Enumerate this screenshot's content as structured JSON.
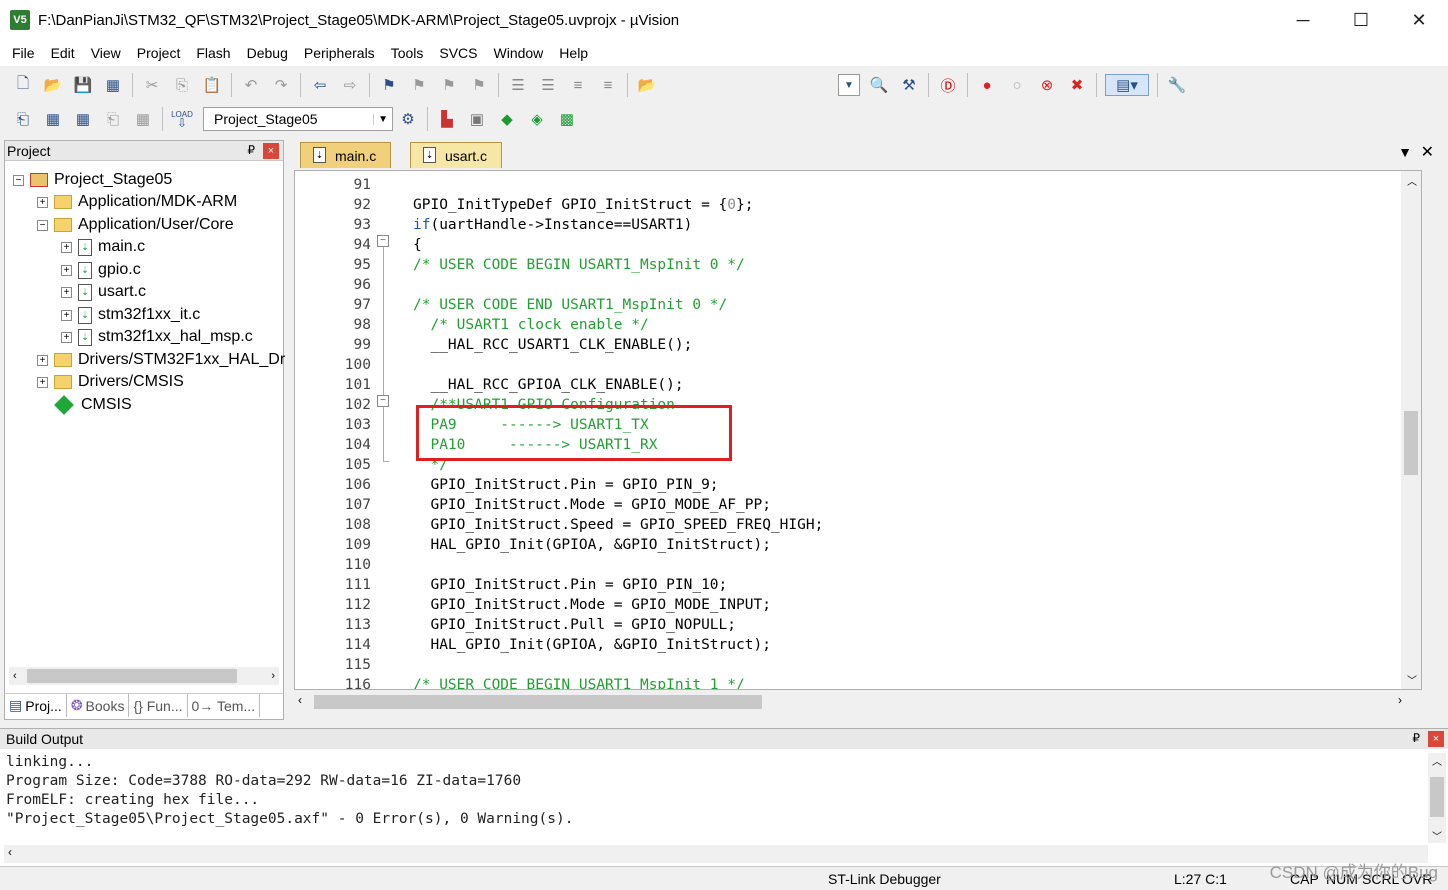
{
  "window": {
    "title": "F:\\DanPianJi\\STM32_QF\\STM32\\Project_Stage05\\MDK-ARM\\Project_Stage05.uvprojx - µVision",
    "app_icon_label": "V5",
    "minimize": "─",
    "maximize": "☐",
    "close": "✕"
  },
  "menu": [
    "File",
    "Edit",
    "View",
    "Project",
    "Flash",
    "Debug",
    "Peripherals",
    "Tools",
    "SVCS",
    "Window",
    "Help"
  ],
  "toolbar2": {
    "target_combo": "Project_Stage05",
    "load_label": "LOAD"
  },
  "project_panel": {
    "title": "Project",
    "pin": "₽",
    "close": "×",
    "tree": [
      {
        "label": "Project_Stage05",
        "level": 0,
        "type": "project",
        "expander": "−"
      },
      {
        "label": "Application/MDK-ARM",
        "level": 1,
        "type": "folder",
        "expander": "+"
      },
      {
        "label": "Application/User/Core",
        "level": 1,
        "type": "folder",
        "expander": "−"
      },
      {
        "label": "main.c",
        "level": 2,
        "type": "file",
        "expander": "+"
      },
      {
        "label": "gpio.c",
        "level": 2,
        "type": "file",
        "expander": "+"
      },
      {
        "label": "usart.c",
        "level": 2,
        "type": "file",
        "expander": "+"
      },
      {
        "label": "stm32f1xx_it.c",
        "level": 2,
        "type": "file",
        "expander": "+"
      },
      {
        "label": "stm32f1xx_hal_msp.c",
        "level": 2,
        "type": "file",
        "expander": "+"
      },
      {
        "label": "Drivers/STM32F1xx_HAL_Dr",
        "level": 1,
        "type": "folder",
        "expander": "+"
      },
      {
        "label": "Drivers/CMSIS",
        "level": 1,
        "type": "folder",
        "expander": "+"
      },
      {
        "label": "CMSIS",
        "level": 1,
        "type": "component",
        "expander": ""
      }
    ],
    "bottom_tabs": [
      "Proj...",
      "Books",
      "{} Fun...",
      "0→ Tem..."
    ]
  },
  "editor": {
    "tabs": [
      "main.c",
      "usart.c"
    ],
    "active_tab": "usart.c",
    "lines": [
      {
        "n": "91",
        "text": ""
      },
      {
        "n": "92",
        "text": "GPIO_InitTypeDef GPIO_InitStruct = {0};"
      },
      {
        "n": "93",
        "text": "if(uartHandle->Instance==USART1)"
      },
      {
        "n": "94",
        "text": "{"
      },
      {
        "n": "95",
        "text": "/* USER CODE BEGIN USART1_MspInit 0 */"
      },
      {
        "n": "96",
        "text": ""
      },
      {
        "n": "97",
        "text": "/* USER CODE END USART1_MspInit 0 */"
      },
      {
        "n": "98",
        "text": "  /* USART1 clock enable */"
      },
      {
        "n": "99",
        "text": "  __HAL_RCC_USART1_CLK_ENABLE();"
      },
      {
        "n": "100",
        "text": ""
      },
      {
        "n": "101",
        "text": "  __HAL_RCC_GPIOA_CLK_ENABLE();"
      },
      {
        "n": "102",
        "text": "  /**USART1 GPIO Configuration"
      },
      {
        "n": "103",
        "text": "  PA9     ------> USART1_TX"
      },
      {
        "n": "104",
        "text": "  PA10     ------> USART1_RX"
      },
      {
        "n": "105",
        "text": "  */"
      },
      {
        "n": "106",
        "text": "  GPIO_InitStruct.Pin = GPIO_PIN_9;"
      },
      {
        "n": "107",
        "text": "  GPIO_InitStruct.Mode = GPIO_MODE_AF_PP;"
      },
      {
        "n": "108",
        "text": "  GPIO_InitStruct.Speed = GPIO_SPEED_FREQ_HIGH;"
      },
      {
        "n": "109",
        "text": "  HAL_GPIO_Init(GPIOA, &GPIO_InitStruct);"
      },
      {
        "n": "110",
        "text": ""
      },
      {
        "n": "111",
        "text": "  GPIO_InitStruct.Pin = GPIO_PIN_10;"
      },
      {
        "n": "112",
        "text": "  GPIO_InitStruct.Mode = GPIO_MODE_INPUT;"
      },
      {
        "n": "113",
        "text": "  GPIO_InitStruct.Pull = GPIO_NOPULL;"
      },
      {
        "n": "114",
        "text": "  HAL_GPIO_Init(GPIOA, &GPIO_InitStruct);"
      },
      {
        "n": "115",
        "text": ""
      },
      {
        "n": "116",
        "text": "/* USER CODE BEGIN USART1_MspInit 1 */"
      }
    ]
  },
  "build_output": {
    "title": "Build Output",
    "text": "linking...\nProgram Size: Code=3788 RO-data=292 RW-data=16 ZI-data=1760\nFromELF: creating hex file...\n\"Project_Stage05\\Project_Stage05.axf\" - 0 Error(s), 0 Warning(s)."
  },
  "status": {
    "debugger": "ST-Link Debugger",
    "position": "L:27 C:1",
    "caps": "CAP",
    "num": "NUM",
    "scrl": "SCRL",
    "ovr": "OVR"
  },
  "watermark": "CSDN @成为你的Bug"
}
